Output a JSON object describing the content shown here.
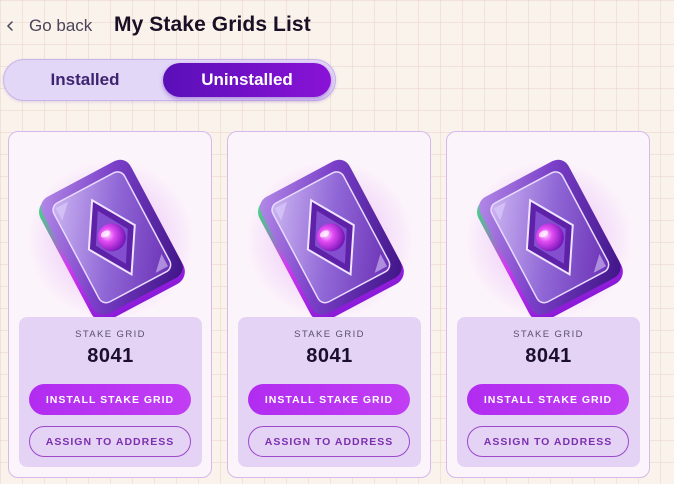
{
  "header": {
    "back_label": "Go back",
    "title": "My Stake Grids List"
  },
  "tabs": {
    "installed_label": "Installed",
    "uninstalled_label": "Uninstalled",
    "active": "Uninstalled"
  },
  "cards": [
    {
      "label": "STAKE GRID",
      "value": "8041",
      "install_label": "INSTALL STAKE GRID",
      "assign_label": "ASSIGN TO ADDRESS"
    },
    {
      "label": "STAKE GRID",
      "value": "8041",
      "install_label": "INSTALL STAKE GRID",
      "assign_label": "ASSIGN TO ADDRESS"
    },
    {
      "label": "STAKE GRID",
      "value": "8041",
      "install_label": "INSTALL STAKE GRID",
      "assign_label": "ASSIGN TO ADDRESS"
    }
  ],
  "icons": {
    "back": "chevron-left-icon",
    "card_art": "stake-grid-card-image"
  },
  "colors": {
    "accent_dark": "#5a0fb8",
    "accent": "#b12cf0",
    "panel": "#e4d3f4",
    "background": "#faf3ec"
  }
}
